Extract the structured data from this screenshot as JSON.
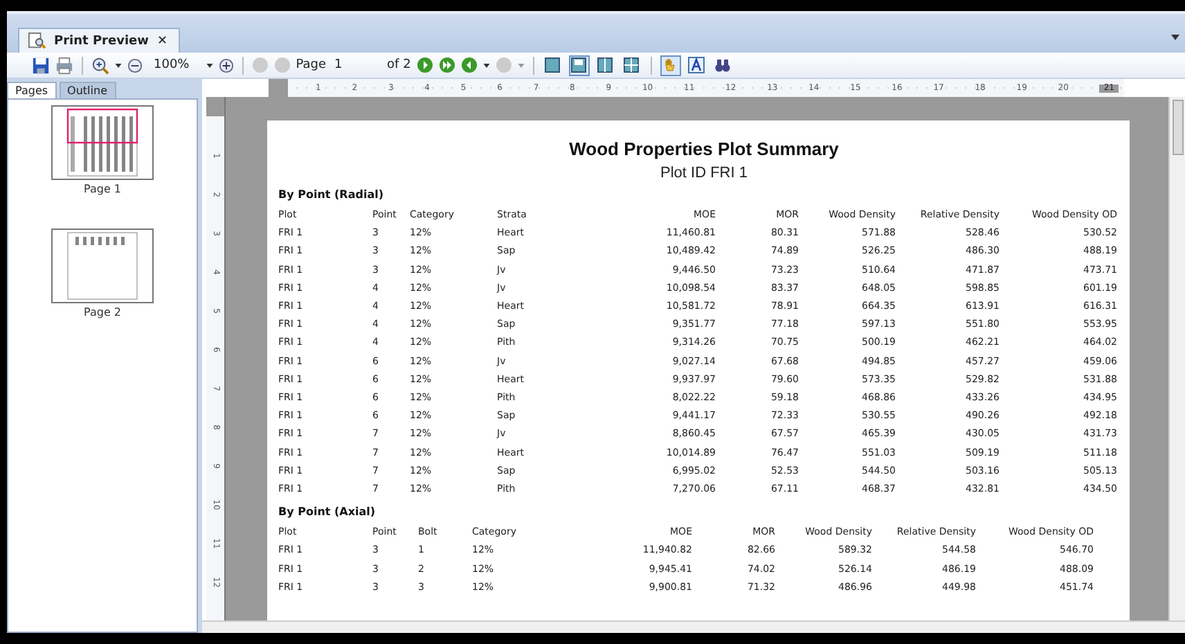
{
  "tab": {
    "title": "Print Preview",
    "close": "✕"
  },
  "toolbar": {
    "zoom": "100%",
    "page_label": "Page",
    "page_value": "1",
    "page_count": "of 2",
    "view_buttons": [
      {
        "selected": false
      },
      {
        "selected": true
      },
      {
        "selected": false
      },
      {
        "selected": false
      }
    ],
    "tools": [
      {
        "kind": "hand",
        "selected": true
      },
      {
        "kind": "text",
        "selected": false
      },
      {
        "kind": "find",
        "selected": false
      }
    ]
  },
  "side_tabs": [
    {
      "label": "Pages",
      "selected": true
    },
    {
      "label": "Outline",
      "selected": false
    }
  ],
  "thumbnails": [
    {
      "label": "Page 1",
      "selected": true
    },
    {
      "label": "Page 2",
      "selected": false
    }
  ],
  "h_ruler": [
    "1",
    "2",
    "3",
    "4",
    "5",
    "6",
    "7",
    "8",
    "9",
    "10",
    "11",
    "12",
    "13",
    "14",
    "15",
    "16",
    "17",
    "18",
    "19",
    "20",
    "21"
  ],
  "v_ruler": [
    "1",
    "2",
    "3",
    "4",
    "5",
    "6",
    "7",
    "8",
    "9",
    "10",
    "11",
    "12"
  ],
  "report": {
    "title": "Wood Properties Plot Summary",
    "subtitle": "Plot ID FRI 1",
    "sections": [
      {
        "heading": "By Point (Radial)",
        "columns": [
          "Plot",
          "Point",
          "Category",
          "Strata",
          "MOE",
          "MOR",
          "Wood Density",
          "Relative Density",
          "Wood Density OD"
        ],
        "rows": [
          [
            "FRI 1",
            "3",
            "12%",
            "Heart",
            "11,460.81",
            "80.31",
            "571.88",
            "528.46",
            "530.52"
          ],
          [
            "FRI 1",
            "3",
            "12%",
            "Sap",
            "10,489.42",
            "74.89",
            "526.25",
            "486.30",
            "488.19"
          ],
          [
            "FRI 1",
            "3",
            "12%",
            "Jv",
            "9,446.50",
            "73.23",
            "510.64",
            "471.87",
            "473.71"
          ],
          [
            "FRI 1",
            "4",
            "12%",
            "Jv",
            "10,098.54",
            "83.37",
            "648.05",
            "598.85",
            "601.19"
          ],
          [
            "FRI 1",
            "4",
            "12%",
            "Heart",
            "10,581.72",
            "78.91",
            "664.35",
            "613.91",
            "616.31"
          ],
          [
            "FRI 1",
            "4",
            "12%",
            "Sap",
            "9,351.77",
            "77.18",
            "597.13",
            "551.80",
            "553.95"
          ],
          [
            "FRI 1",
            "4",
            "12%",
            "Pith",
            "9,314.26",
            "70.75",
            "500.19",
            "462.21",
            "464.02"
          ],
          [
            "FRI 1",
            "6",
            "12%",
            "Jv",
            "9,027.14",
            "67.68",
            "494.85",
            "457.27",
            "459.06"
          ],
          [
            "FRI 1",
            "6",
            "12%",
            "Heart",
            "9,937.97",
            "79.60",
            "573.35",
            "529.82",
            "531.88"
          ],
          [
            "FRI 1",
            "6",
            "12%",
            "Pith",
            "8,022.22",
            "59.18",
            "468.86",
            "433.26",
            "434.95"
          ],
          [
            "FRI 1",
            "6",
            "12%",
            "Sap",
            "9,441.17",
            "72.33",
            "530.55",
            "490.26",
            "492.18"
          ],
          [
            "FRI 1",
            "7",
            "12%",
            "Jv",
            "8,860.45",
            "67.57",
            "465.39",
            "430.05",
            "431.73"
          ],
          [
            "FRI 1",
            "7",
            "12%",
            "Heart",
            "10,014.89",
            "76.47",
            "551.03",
            "509.19",
            "511.18"
          ],
          [
            "FRI 1",
            "7",
            "12%",
            "Sap",
            "6,995.02",
            "52.53",
            "544.50",
            "503.16",
            "505.13"
          ],
          [
            "FRI 1",
            "7",
            "12%",
            "Pith",
            "7,270.06",
            "67.11",
            "468.37",
            "432.81",
            "434.50"
          ]
        ]
      },
      {
        "heading": "By Point (Axial)",
        "columns": [
          "Plot",
          "Point",
          "Bolt",
          "Category",
          "MOE",
          "MOR",
          "Wood Density",
          "Relative Density",
          "Wood Density OD"
        ],
        "rows": [
          [
            "FRI 1",
            "3",
            "1",
            "12%",
            "11,940.82",
            "82.66",
            "589.32",
            "544.58",
            "546.70"
          ],
          [
            "FRI 1",
            "3",
            "2",
            "12%",
            "9,945.41",
            "74.02",
            "526.14",
            "486.19",
            "488.09"
          ],
          [
            "FRI 1",
            "3",
            "3",
            "12%",
            "9,900.81",
            "71.32",
            "486.96",
            "449.98",
            "451.74"
          ]
        ]
      }
    ]
  }
}
